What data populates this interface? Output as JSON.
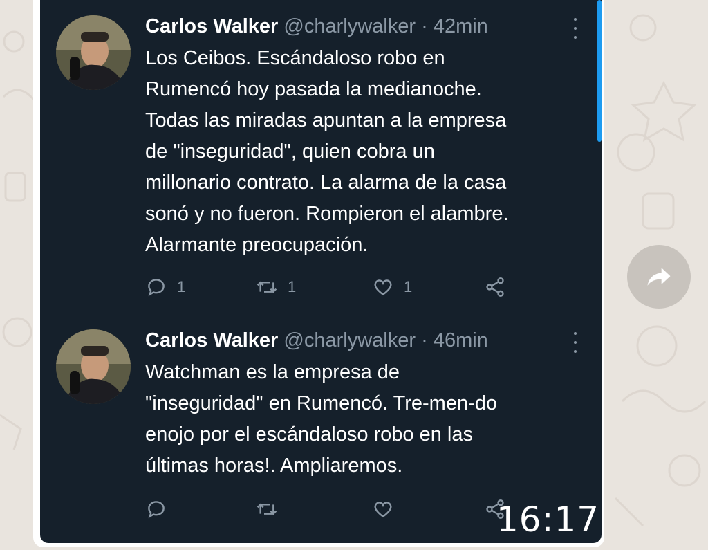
{
  "tweets": [
    {
      "name": "Carlos Walker",
      "handle": "@charlywalker",
      "separator": "·",
      "time": "42min",
      "text": "Los Ceibos. Escándaloso robo en\nRumencó hoy pasada la medianoche.\nTodas las miradas apuntan a la empresa\nde \"inseguridad\", quien cobra un\nmillonario contrato. La alarma de la casa\nsonó y no fueron. Rompieron el alambre.\nAlarmante preocupación.",
      "replies": "1",
      "retweets": "1",
      "likes": "1"
    },
    {
      "name": "Carlos Walker",
      "handle": "@charlywalker",
      "separator": "·",
      "time": "46min",
      "text": "Watchman es la empresa de\n\"inseguridad\" en Rumencó. Tre-men-do\nenojo por el escándaloso robo en las\núltimas horas!. Ampliaremos.",
      "replies": "",
      "retweets": "",
      "likes": ""
    }
  ],
  "message_time": "16:17",
  "icons": {
    "reply": "reply-icon",
    "retweet": "retweet-icon",
    "like": "heart-icon",
    "share": "share-icon",
    "more": "more-vertical-icon",
    "forward": "forward-icon"
  },
  "colors": {
    "card_bg": "#15202b",
    "text_primary": "#ffffff",
    "text_secondary": "#8b98a5",
    "accent": "#1d9bf0",
    "chat_bg": "#e9e4de"
  }
}
